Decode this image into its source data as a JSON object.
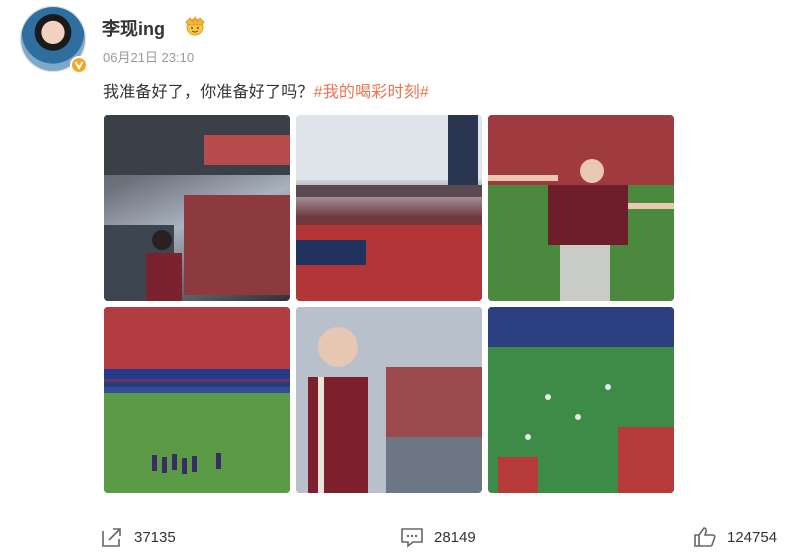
{
  "post": {
    "username": "李现ing",
    "timestamp": "06月21日 23:10",
    "text_main": "我准备好了，你准备好了吗？",
    "hashtag": "#我的喝彩时刻#"
  },
  "photos": [
    {
      "name": "stadium-seats-photo",
      "alt": "Man in maroon jersey seated in stadium stands"
    },
    {
      "name": "stadium-roof-photo",
      "alt": "Stadium interior with red seats and roof"
    },
    {
      "name": "arms-outstretched-photo",
      "alt": "Man with arms outstretched in stadium"
    },
    {
      "name": "pitch-players-photo",
      "alt": "Football pitch with players in stadium"
    },
    {
      "name": "window-portrait-photo",
      "alt": "Man looking out over stadium"
    },
    {
      "name": "green-crowd-photo",
      "alt": "Crowd in green jerseys in stands"
    }
  ],
  "actions": {
    "share_count": "37135",
    "comment_count": "28149",
    "like_count": "124754"
  },
  "colors": {
    "hashtag": "#eb7350",
    "timestamp": "#999999",
    "verified_badge": "#f5a623"
  }
}
